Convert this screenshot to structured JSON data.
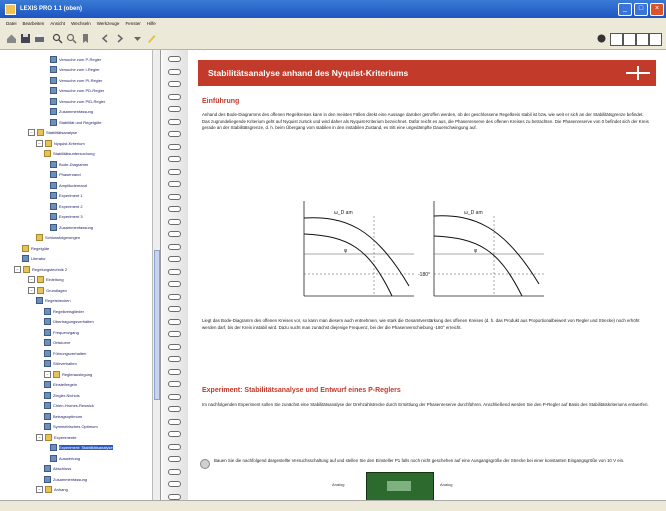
{
  "window": {
    "title": "LEXIS PRO 1.1 (oben)"
  },
  "menu": [
    "Datei",
    "Bearbeiten",
    "Ansicht",
    "Wechseln",
    "Werkzeuge",
    "Fenster",
    "Hilfe"
  ],
  "tree": [
    {
      "label": "Versuche zum P-Regler"
    },
    {
      "label": "Versuche zum I-Regler"
    },
    {
      "label": "Versuche zum PI-Regler"
    },
    {
      "label": "Versuche zum PD-Regler"
    },
    {
      "label": "Versuche zum PID-Regler"
    },
    {
      "label": "Zusammenfassung"
    },
    {
      "label": "Stabilität und Regelgüte"
    },
    {
      "label": "Stabilitätsanalyse"
    },
    {
      "label": "Nyquist-Kriterium"
    },
    {
      "label": "Stabilitätsuntersuchung"
    },
    {
      "label": "Bode-Diagramm"
    },
    {
      "label": "Phasenrand"
    },
    {
      "label": "Amplitudenrand"
    },
    {
      "label": "Experiment 1"
    },
    {
      "label": "Experiment 2"
    },
    {
      "label": "Experiment 3"
    },
    {
      "label": "Zusammenfassung"
    },
    {
      "label": "Schlussfolgerungen"
    },
    {
      "label": "Regelgüte"
    },
    {
      "label": "Literatur"
    },
    {
      "label": "Regelungstechnik 2"
    },
    {
      "label": "Einleitung"
    },
    {
      "label": "Grundlagen"
    },
    {
      "label": "Regelstrecken"
    },
    {
      "label": "Regelkreisglieder"
    },
    {
      "label": "Übertragungsverhalten"
    },
    {
      "label": "Frequenzgang"
    },
    {
      "label": "Ortskurve"
    },
    {
      "label": "Führungsverhalten"
    },
    {
      "label": "Störverhalten"
    },
    {
      "label": "Reglerauslegung"
    },
    {
      "label": "Einstellregeln"
    },
    {
      "label": "Ziegler-Nichols"
    },
    {
      "label": "Chien-Hrones-Reswick"
    },
    {
      "label": "Betragsoptimum"
    },
    {
      "label": "Symmetrisches Optimum"
    },
    {
      "label": "Experimente"
    },
    {
      "label": "Experiment: Stabilitätsanalyse"
    },
    {
      "label": "Auswertung"
    },
    {
      "label": "Abschluss"
    },
    {
      "label": "Zusammenfassung"
    },
    {
      "label": "Anhang"
    }
  ],
  "page": {
    "banner_title": "Stabilitätsanalyse anhand des Nyquist-Kriteriums",
    "h_intro": "Einführung",
    "p1": "Anhand des Bode-Diagramms des offenen Regelkreises kann in den meisten Fällen direkt eine Aussage darüber getroffen werden, ob der geschlossene Regelkreis stabil ist bzw. wie weit er sich an der Stabilitätsgrenze befindet. Das zugrundeliegende Kriterium geht auf Nyquist zurück und wird daher als Nyquist-Kriterium bezeichnet. Dafür reicht es aus, die Phasenreserve des offenen Kreises zu betrachten. Die Phasenreserve von 0 befindet sich der Kreis gerade an der Stabilitätsgrenze, d. h. beim Übergang vom stabilen in den instabilen Zustand, es tritt eine ungedämpfte Dauerschwingung auf.",
    "diagram_labels": {
      "left_top": "ω_D am",
      "left_mid": "φ",
      "right_top": "ω_D am",
      "right_mid": "φ",
      "center": "-180°"
    },
    "p2": "Liegt das Bode-Diagramm des offenen Kreises vor, so kann man diesem auch entnehmen, wie stark die Gesamtverstärkung des offenen Kreises (d. h. das Produkt aus Proportionalbeiwert von Regler und Strecke) noch erhöht werden darf, bis der Kreis instabil wird. Dazu sucht man zunächst diejenige Frequenz, bei der die Phasenverschiebung -180° erreicht.",
    "h_experiment": "Experiment: Stabilitätsanalyse und Entwurf eines P-Reglers",
    "p3": "Im nachfolgenden Experiment sollen Sie zunächst eine Stabilitätsanalyse der Drehzahlstrecke durch Ermittlung der Phasenreserve durchführen. Anschließend werden Sie den P-Regler auf Basis des Stabilitätskriteriums entwerfen.",
    "bullet_text": "Bauen Sie die nachfolgend dargestellte Versuchsschaltung auf und stellen Sie den Einsteller P1 falls noch nicht geschehen auf eine Ausgangsgröße der Strecke bei einer konstanten Eingangsgröße von 10 V ein.",
    "caption_left": "Analog",
    "caption_right": "Analog"
  },
  "status": {
    "text": ""
  }
}
